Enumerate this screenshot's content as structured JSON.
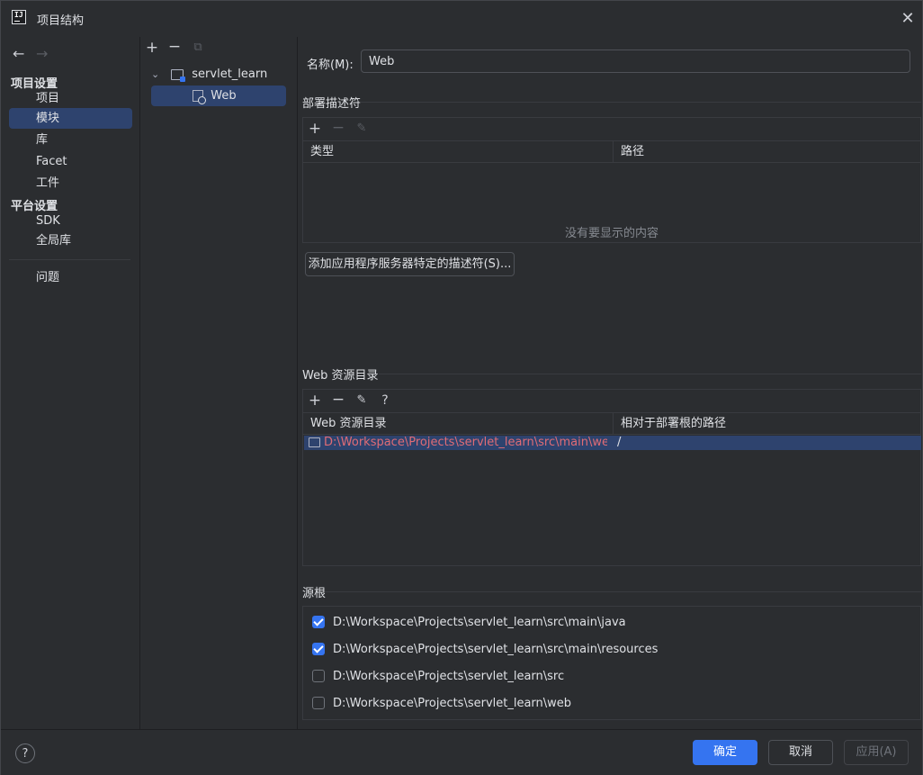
{
  "window": {
    "title": "项目结构"
  },
  "sidebar": {
    "project_settings": "项目设置",
    "items_project": [
      {
        "label": "项目"
      },
      {
        "label": "模块"
      },
      {
        "label": "库"
      },
      {
        "label": "Facet"
      },
      {
        "label": "工件"
      }
    ],
    "platform_settings": "平台设置",
    "items_platform": [
      {
        "label": "SDK"
      },
      {
        "label": "全局库"
      }
    ],
    "problems": "问题",
    "selected": "模块"
  },
  "tree": {
    "module": "servlet_learn",
    "facet": "Web"
  },
  "detail": {
    "name_label": "名称(M):",
    "name_value": "Web",
    "deploy_section": "部署描述符",
    "deploy_columns": [
      "类型",
      "路径"
    ],
    "deploy_empty": "没有要显示的内容",
    "add_descriptor_button": "添加应用程序服务器特定的描述符(S)...",
    "web_res_section": "Web 资源目录",
    "web_res_columns": [
      "Web 资源目录",
      "相对于部署根的路径"
    ],
    "web_res_rows": [
      {
        "dir": "D:\\Workspace\\Projects\\servlet_learn\\src\\main\\weba...",
        "rel": "/"
      }
    ],
    "source_roots_section": "源根",
    "source_roots": [
      {
        "path": "D:\\Workspace\\Projects\\servlet_learn\\src\\main\\java",
        "checked": true
      },
      {
        "path": "D:\\Workspace\\Projects\\servlet_learn\\src\\main\\resources",
        "checked": true
      },
      {
        "path": "D:\\Workspace\\Projects\\servlet_learn\\src",
        "checked": false
      },
      {
        "path": "D:\\Workspace\\Projects\\servlet_learn\\web",
        "checked": false
      }
    ]
  },
  "footer": {
    "ok": "确定",
    "cancel": "取消",
    "apply": "应用(A)"
  },
  "colors": {
    "accent": "#3574f0",
    "selection": "#2e436e",
    "error_path": "#e06c75"
  }
}
